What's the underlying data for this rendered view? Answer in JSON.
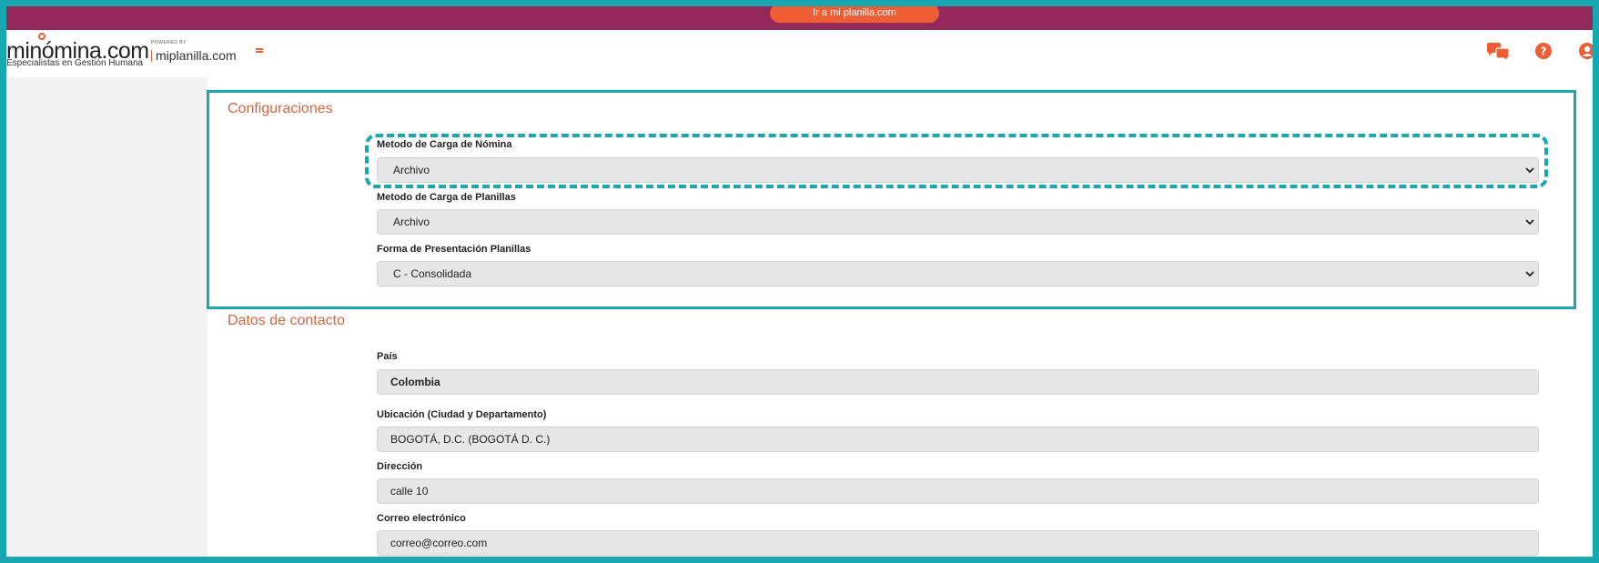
{
  "topbar": {
    "cta_label": "Ir a mi planilla.com"
  },
  "header": {
    "logo_text": "minómina.com",
    "logo_tagline": "Especialistas en Gestión Humana",
    "powered_by": "POWERED BY",
    "partner_text": "miplanilla.com",
    "icons": [
      "chat-icon",
      "help-icon",
      "user-icon"
    ]
  },
  "colors": {
    "brand_purple": "#93295b",
    "accent_orange": "#ee5d33",
    "highlight_teal": "#17a8b1",
    "section_title": "#d2653f"
  },
  "configuraciones": {
    "title": "Configuraciones",
    "nomina_label": "Metodo de Carga de Nómina",
    "nomina_value": "Archivo",
    "planillas_label": "Metodo de Carga de Planillas",
    "planillas_value": "Archivo",
    "presentacion_label": "Forma de Presentación Planillas",
    "presentacion_value": "C - Consolidada"
  },
  "contacto": {
    "title": "Datos de contacto",
    "pais_label": "País",
    "pais_value": "Colombia",
    "ubicacion_label": "Ubicación (Ciudad y Departamento)",
    "ubicacion_value": "BOGOTÁ, D.C. (BOGOTÁ  D. C.)",
    "direccion_label": "Dirección",
    "direccion_value": "calle 10",
    "correo_label": "Correo electrónico",
    "correo_value": "correo@correo.com"
  }
}
